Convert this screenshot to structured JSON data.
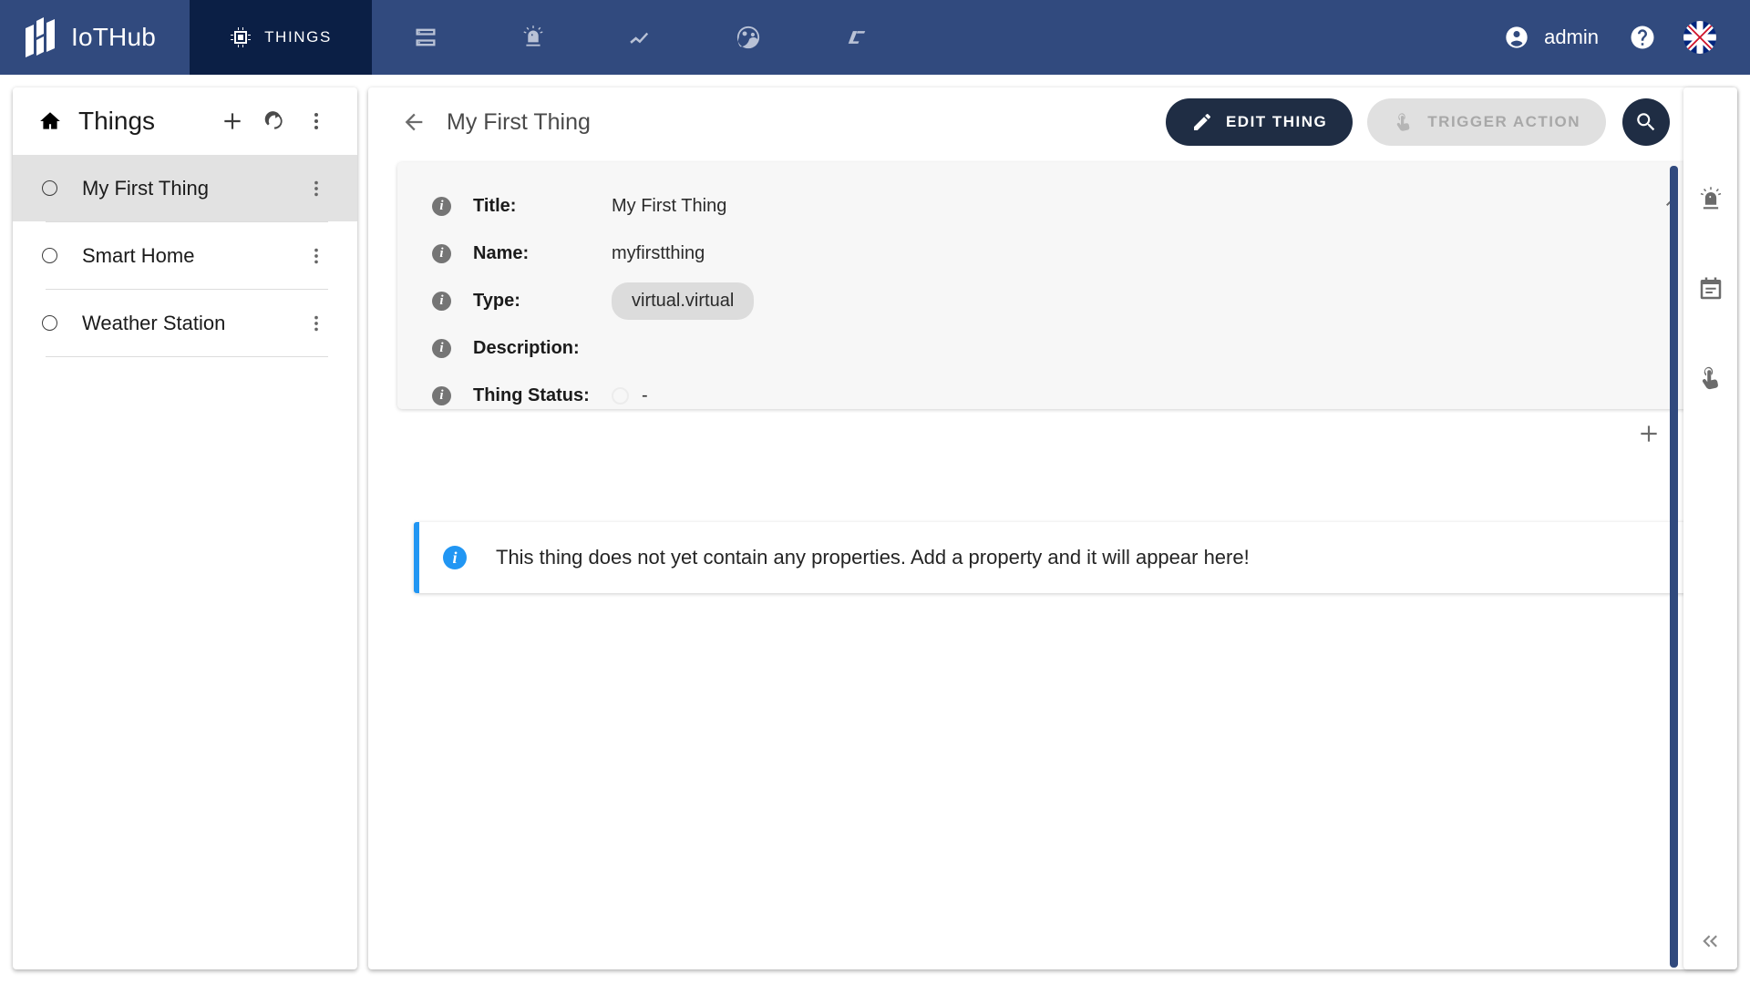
{
  "app": {
    "brand_name": "IoTHub",
    "accent_navy": "#314a7e",
    "accent_dark": "#0b1f45",
    "info_blue": "#2196f3"
  },
  "topbar": {
    "active_tab_label": "THINGS",
    "nav_icons": [
      {
        "name": "devices-rack-icon"
      },
      {
        "name": "alarm-siren-icon"
      },
      {
        "name": "analytics-trend-icon"
      },
      {
        "name": "users-group-icon"
      },
      {
        "name": "dashboard-lt-icon"
      }
    ],
    "account_label": "admin",
    "help_icon": "help-circle-icon",
    "language_flag": "uk-flag-icon"
  },
  "sidebar": {
    "title": "Things",
    "home_icon": "home-icon",
    "add_icon": "plus-icon",
    "refresh_icon": "refresh-icon",
    "menu_icon": "more-vertical-icon",
    "items": [
      {
        "label": "My First Thing",
        "selected": true
      },
      {
        "label": "Smart Home",
        "selected": false
      },
      {
        "label": "Weather Station",
        "selected": false
      }
    ]
  },
  "main": {
    "back_icon": "arrow-left-icon",
    "title": "My First Thing",
    "edit_button_label": "EDIT THING",
    "edit_button_icon": "pencil-icon",
    "trigger_button_label": "TRIGGER ACTION",
    "trigger_button_icon": "touch-pointer-icon",
    "trigger_button_disabled": true,
    "search_icon": "search-icon",
    "menu_icon": "more-vertical-icon",
    "details": {
      "collapse_icon": "chevron-up-icon",
      "rows": [
        {
          "label": "Title:",
          "value": "My First Thing",
          "kind": "text"
        },
        {
          "label": "Name:",
          "value": "myfirstthing",
          "kind": "text"
        },
        {
          "label": "Type:",
          "value": "virtual.virtual",
          "kind": "chip"
        },
        {
          "label": "Description:",
          "value": "",
          "kind": "text"
        },
        {
          "label": "Thing Status:",
          "value": "-",
          "kind": "status"
        }
      ]
    },
    "toolbar": {
      "add_icon": "plus-icon",
      "table_view_icon": "table-grid-icon"
    },
    "banner": {
      "icon": "info-circle-icon",
      "text": "This thing does not yet contain any properties. Add a property and it will appear here!"
    }
  },
  "rail": {
    "icons": [
      {
        "name": "alarm-siren-icon"
      },
      {
        "name": "calendar-event-icon"
      },
      {
        "name": "touch-trigger-icon"
      }
    ],
    "collapse_icon": "chevron-double-left-icon"
  }
}
